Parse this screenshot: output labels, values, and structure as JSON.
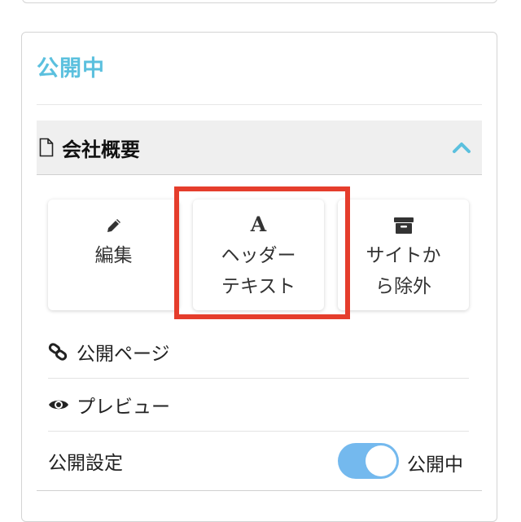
{
  "header": {
    "status": "公開中"
  },
  "section": {
    "page_name": "会社概要",
    "expanded": true
  },
  "actions": [
    {
      "icon": "pencil-icon",
      "label_line1": "編集",
      "label_line2": ""
    },
    {
      "icon": "font-a-icon",
      "glyph": "A",
      "label_line1": "ヘッダー",
      "label_line2": "テキスト",
      "highlighted": true
    },
    {
      "icon": "archive-box-icon",
      "label_line1": "サイトか",
      "label_line2": "ら除外"
    }
  ],
  "links": [
    {
      "icon": "link-icon",
      "label": "公開ページ"
    },
    {
      "icon": "eye-icon",
      "label": "プレビュー"
    }
  ],
  "publish": {
    "label": "公開設定",
    "toggle_on": true,
    "state_label": "公開中"
  },
  "colors": {
    "accent": "#5bc0de",
    "toggle": "#74b9ee",
    "highlight": "#e53d2c"
  }
}
